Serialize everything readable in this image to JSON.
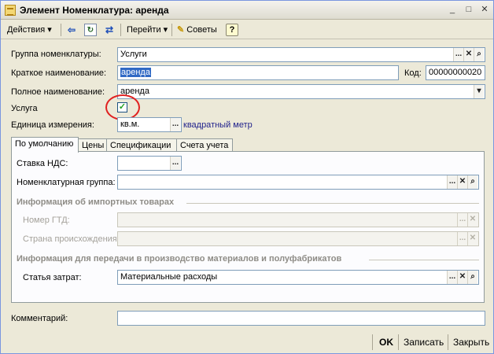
{
  "window": {
    "title": "Элемент Номенклатура: аренда",
    "controls": {
      "minimize": "_",
      "maximize": "□",
      "close": "✕"
    }
  },
  "toolbar": {
    "actions_label": "Действия",
    "goto_label": "Перейти",
    "tips_label": "Советы",
    "help_label": "?",
    "icons": [
      "back-icon",
      "refresh-icon",
      "swap-icon",
      "tips-icon",
      "help-icon"
    ]
  },
  "form": {
    "group_label": "Группа номенклатуры:",
    "group_value": "Услуги",
    "short_name_label": "Краткое наименование:",
    "short_name_value": "аренда",
    "code_label": "Код:",
    "code_value": "00000000020",
    "full_name_label": "Полное наименование:",
    "full_name_value": "аренда",
    "service_label": "Услуга",
    "service_checked": true,
    "unit_label": "Единица измерения:",
    "unit_value": "кв.м.",
    "unit_link": "квадратный метр"
  },
  "tabs": [
    {
      "label": "По умолчанию",
      "active": true
    },
    {
      "label": "Цены",
      "active": false
    },
    {
      "label": "Спецификации",
      "active": false
    },
    {
      "label": "Счета учета",
      "active": false
    }
  ],
  "default_tab": {
    "vat_label": "Ставка НДС:",
    "vat_value": "",
    "nom_group_label": "Номенклатурная группа:",
    "nom_group_value": "",
    "import_header": "Информация об импортных товарах",
    "gtd_label": "Номер ГТД:",
    "gtd_value": "",
    "origin_label": "Страна происхождения:",
    "origin_value": "",
    "production_header": "Информация для передачи в производство материалов и полуфабрикатов",
    "cost_item_label": "Статья затрат:",
    "cost_item_value": "Материальные расходы"
  },
  "comment": {
    "label": "Комментарий:",
    "value": ""
  },
  "footer": {
    "ok_label": "OK",
    "save_label": "Записать",
    "close_label": "Закрыть"
  },
  "colors": {
    "titlebar": "#dedcd0",
    "window_bg": "#ece9d8",
    "selection": "#316ac5",
    "link": "#22238c",
    "annotation_circle": "#e02020"
  }
}
